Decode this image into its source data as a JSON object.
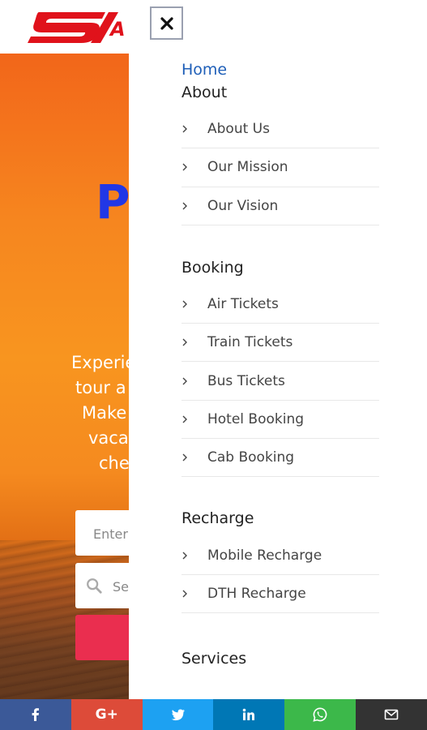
{
  "background": {
    "logo_suffix": "A",
    "hero_letter": "P",
    "hero_lines": [
      "Experie",
      "tour a",
      "Make",
      "vaca",
      "che"
    ],
    "input_enter_placeholder": "Enter",
    "input_search_placeholder": "Se"
  },
  "drawer": {
    "close_icon": "close-icon",
    "home_label": "Home",
    "sections": [
      {
        "title": "About",
        "items": [
          "About Us",
          "Our Mission",
          "Our Vision"
        ]
      },
      {
        "title": "Booking",
        "items": [
          "Air Tickets",
          "Train Tickets",
          "Bus Tickets",
          "Hotel Booking",
          "Cab Booking"
        ]
      },
      {
        "title": "Recharge",
        "items": [
          "Mobile Recharge",
          "DTH Recharge"
        ]
      },
      {
        "title": "Services",
        "items": []
      }
    ]
  },
  "share_bar": [
    {
      "name": "facebook",
      "icon": "facebook-icon",
      "color": "#3b5998"
    },
    {
      "name": "google-plus",
      "icon": "google-plus-icon",
      "color": "#dd4b39",
      "text": "G+"
    },
    {
      "name": "twitter",
      "icon": "twitter-icon",
      "color": "#1da1f2"
    },
    {
      "name": "linkedin",
      "icon": "linkedin-icon",
      "color": "#0077b5"
    },
    {
      "name": "whatsapp",
      "icon": "whatsapp-icon",
      "color": "#3cb84a"
    },
    {
      "name": "email",
      "icon": "email-icon",
      "color": "#333333"
    }
  ],
  "colors": {
    "home_link": "#1f5fb8",
    "hero_letter": "#2137e6",
    "cta_button": "#ea2e4f",
    "logo_red": "#e0121b"
  }
}
